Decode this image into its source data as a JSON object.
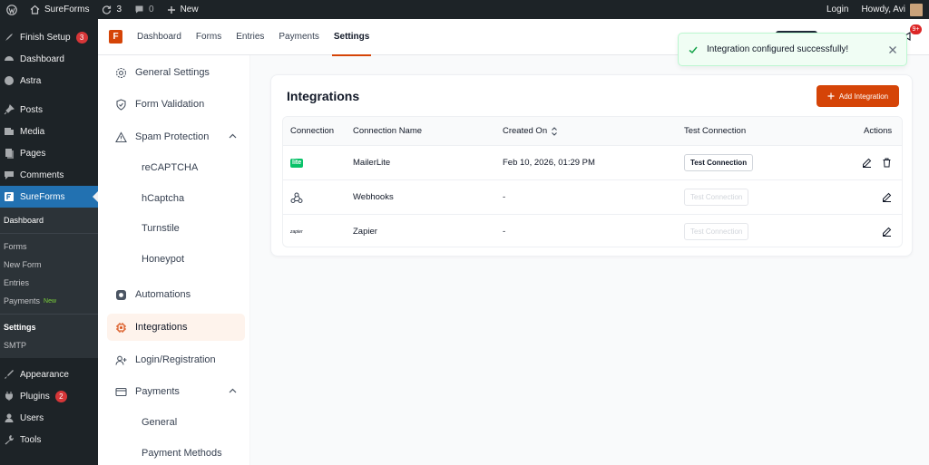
{
  "admin_bar": {
    "site_name": "SureForms",
    "updates_count": "3",
    "comments_count": "0",
    "new_label": "New",
    "login_label": "Login",
    "howdy": "Howdy, Avi"
  },
  "wp_menu": {
    "finish_setup": "Finish Setup",
    "finish_setup_badge": "3",
    "dashboard": "Dashboard",
    "astra": "Astra",
    "posts": "Posts",
    "media": "Media",
    "pages": "Pages",
    "comments": "Comments",
    "sureforms": "SureForms",
    "sub_dashboard": "Dashboard",
    "sub_forms": "Forms",
    "sub_new_form": "New Form",
    "sub_entries": "Entries",
    "sub_payments": "Payments",
    "sub_payments_tag": "New",
    "sub_settings": "Settings",
    "sub_smtp": "SMTP",
    "appearance": "Appearance",
    "plugins": "Plugins",
    "plugins_badge": "2",
    "users": "Users",
    "tools": "Tools"
  },
  "top_nav": {
    "logo_letter": "F",
    "tabs": [
      "Dashboard",
      "Forms",
      "Entries",
      "Payments",
      "Settings"
    ],
    "active_tab": "Settings",
    "notification_badge": "9+"
  },
  "toast": {
    "message": "Integration configured successfully!",
    "status_color": "#16a34a"
  },
  "settings_nav": {
    "general": "General Settings",
    "form_validation": "Form Validation",
    "spam_protection": "Spam Protection",
    "recaptcha": "reCAPTCHA",
    "hcaptcha": "hCaptcha",
    "turnstile": "Turnstile",
    "honeypot": "Honeypot",
    "automations": "Automations",
    "integrations": "Integrations",
    "login_registration": "Login/Registration",
    "payments": "Payments",
    "payments_general": "General",
    "payment_methods": "Payment Methods"
  },
  "integrations": {
    "title": "Integrations",
    "add_button": "Add Integration",
    "accent_color": "#d54407",
    "columns": {
      "connection": "Connection",
      "name": "Connection Name",
      "created": "Created On",
      "test": "Test Connection",
      "actions": "Actions"
    },
    "rows": [
      {
        "logo": "lite",
        "name": "MailerLite",
        "created": "Feb 10, 2026, 01:29 PM",
        "test_label": "Test Connection",
        "test_enabled": true,
        "can_delete": true
      },
      {
        "logo": "webhook-icon",
        "name": "Webhooks",
        "created": "-",
        "test_label": "Test Connection",
        "test_enabled": false,
        "can_delete": false
      },
      {
        "logo": "zapier",
        "name": "Zapier",
        "created": "-",
        "test_label": "Test Connection",
        "test_enabled": false,
        "can_delete": false
      }
    ]
  }
}
